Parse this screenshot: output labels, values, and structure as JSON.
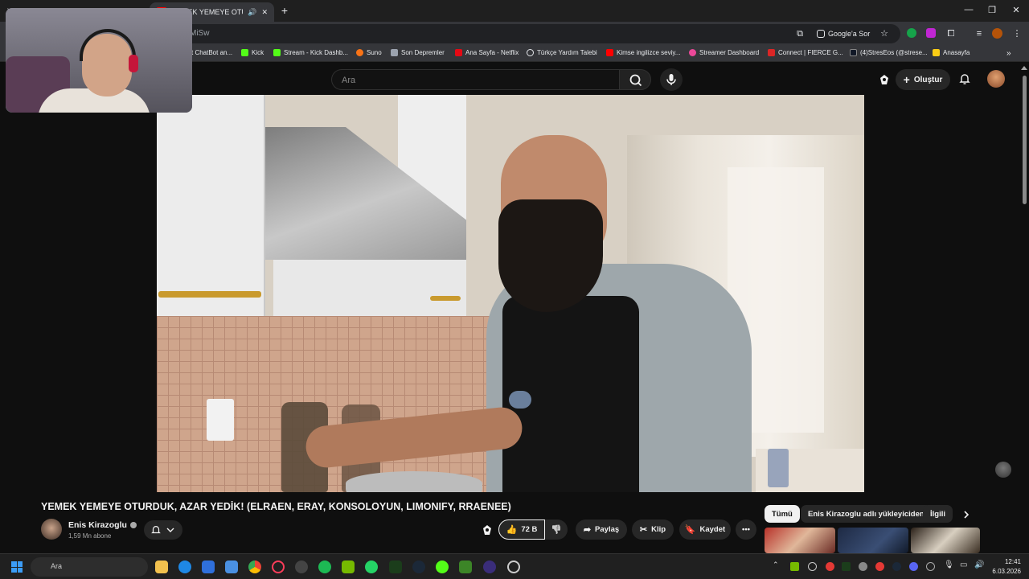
{
  "browser": {
    "tab_title": "YEMEK YEMEYE OTURDUK,",
    "url_fragment": "MiSw",
    "google_sor_label": "Google'a Sor",
    "bookmarks": [
      {
        "label": "t ChatBot an...",
        "color": "#6b7280"
      },
      {
        "label": "Kick",
        "color": "#53fc18"
      },
      {
        "label": "Stream - Kick Dashb...",
        "color": "#53fc18"
      },
      {
        "label": "Suno",
        "color": "#f97316"
      },
      {
        "label": "Son Depremler",
        "color": "#9ca3af"
      },
      {
        "label": "Ana Sayfa - Netflix",
        "color": "#e50914"
      },
      {
        "label": "Türkçe Yardım Talebi",
        "color": "#e5e7eb"
      },
      {
        "label": "Kimse ingilizce seviy...",
        "color": "#ff0000"
      },
      {
        "label": "Streamer Dashboard",
        "color": "#ec4899"
      },
      {
        "label": "Connect | FIERCE G...",
        "color": "#dc2626"
      },
      {
        "label": "(4)StresEos (@strese...",
        "color": "#111827"
      },
      {
        "label": "Anasayfa",
        "color": "#facc15"
      }
    ]
  },
  "youtube": {
    "search_placeholder": "Ara",
    "create_label": "Oluştur",
    "video_title": "YEMEK YEMEYE OTURDUK, AZAR YEDİK! (ELRAEN, ERAY, KONSOLOYUN, LIMONIFY, RRAENEE)",
    "channel_name": "Enis Kirazoglu",
    "channel_subs": "1,59 Mn abone",
    "like_count": "72 B",
    "share_label": "Paylaş",
    "clip_label": "Klip",
    "save_label": "Kaydet",
    "chips": [
      "Tümü",
      "Enis Kirazoglu adlı yükleyiciden",
      "İlgili"
    ]
  },
  "taskbar": {
    "search_placeholder": "Ara",
    "time": "12:41",
    "date": "6.03.2026"
  }
}
